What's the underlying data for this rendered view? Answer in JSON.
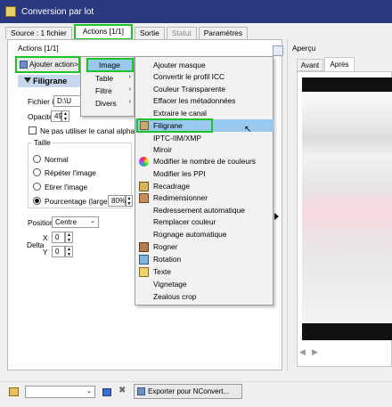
{
  "window": {
    "title": "Conversion par lot"
  },
  "tabs": [
    {
      "label": "Source : 1 fichier"
    },
    {
      "label": "Actions [1/1]"
    },
    {
      "label": "Sortie"
    },
    {
      "label": "Statut"
    },
    {
      "label": "Paramètres"
    }
  ],
  "actions": {
    "count_label": "Actions [1/1]",
    "add_button": "Ajouter action>",
    "section_title": "Filigrane",
    "image_file_label": "Fichier image",
    "image_file_value": "D:\\U",
    "opacity_label": "Opacité",
    "opacity_value": "49",
    "alpha_checkbox": "Ne pas utiliser le canal alpha",
    "size_label": "Taille",
    "size_options": [
      "Normal",
      "Répéter l'image",
      "Etirer l'image",
      "Pourcentage (largeur)"
    ],
    "percent_value": "80%",
    "position_label": "Position",
    "position_value": "Centre",
    "delta_label": "Delta",
    "x_label": "X",
    "x_value": "0",
    "y_label": "Y",
    "y_value": "0"
  },
  "category_menu": [
    {
      "label": "Image"
    },
    {
      "label": "Table"
    },
    {
      "label": "Filtre"
    },
    {
      "label": "Divers"
    }
  ],
  "image_menu": [
    {
      "label": "Ajouter masque"
    },
    {
      "label": "Convertir le profil ICC"
    },
    {
      "label": "Couleur Transparente"
    },
    {
      "label": "Effacer les métadonnées"
    },
    {
      "label": "Extraire le canal"
    },
    {
      "label": "Filigrane"
    },
    {
      "label": "IPTC-IIM/XMP"
    },
    {
      "label": "Miroir"
    },
    {
      "label": "Modifier le nombre de couleurs"
    },
    {
      "label": "Modifier les PPI"
    },
    {
      "label": "Recadrage"
    },
    {
      "label": "Redimensionner"
    },
    {
      "label": "Redressement automatique"
    },
    {
      "label": "Remplacer couleur"
    },
    {
      "label": "Rognage automatique"
    },
    {
      "label": "Rogner"
    },
    {
      "label": "Rotation"
    },
    {
      "label": "Texte"
    },
    {
      "label": "Vignetage"
    },
    {
      "label": "Zealous crop"
    }
  ],
  "preview": {
    "title": "Aperçu",
    "tabs": [
      {
        "label": "Avant"
      },
      {
        "label": "Après"
      }
    ]
  },
  "bottom": {
    "export_button": "Exporter pour NConvert..."
  },
  "colors": {
    "highlight_green": "#1ec425",
    "menu_selection": "#99c9ef",
    "section_header": "#c7d8ee",
    "titlebar": "#2b3a80"
  }
}
